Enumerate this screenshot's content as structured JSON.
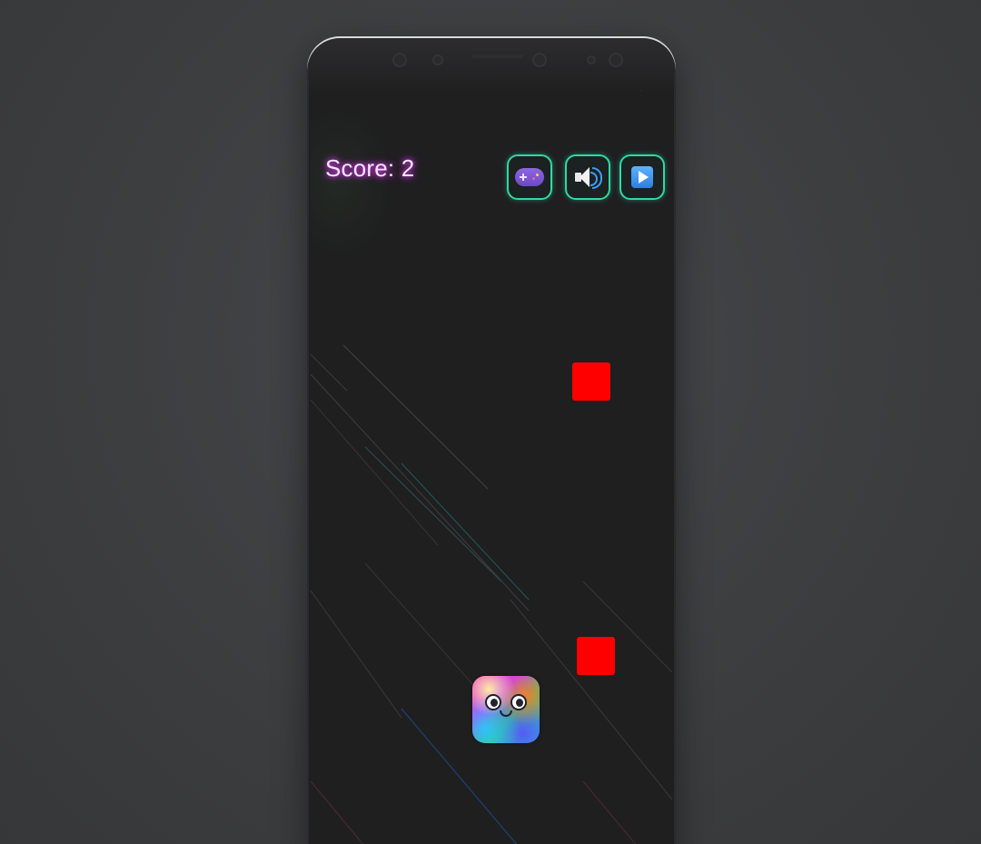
{
  "hud": {
    "score_label": "Score: 2"
  },
  "controls": [
    {
      "name": "controller-button",
      "icon": "gamepad-icon"
    },
    {
      "name": "sound-button",
      "icon": "speaker-icon"
    },
    {
      "name": "play-button",
      "icon": "play-icon"
    }
  ],
  "game": {
    "obstacles": 2,
    "obstacle_color": "#ff0000",
    "accent_color": "#2fd9a3",
    "score_glow_color": "#e040fb"
  }
}
